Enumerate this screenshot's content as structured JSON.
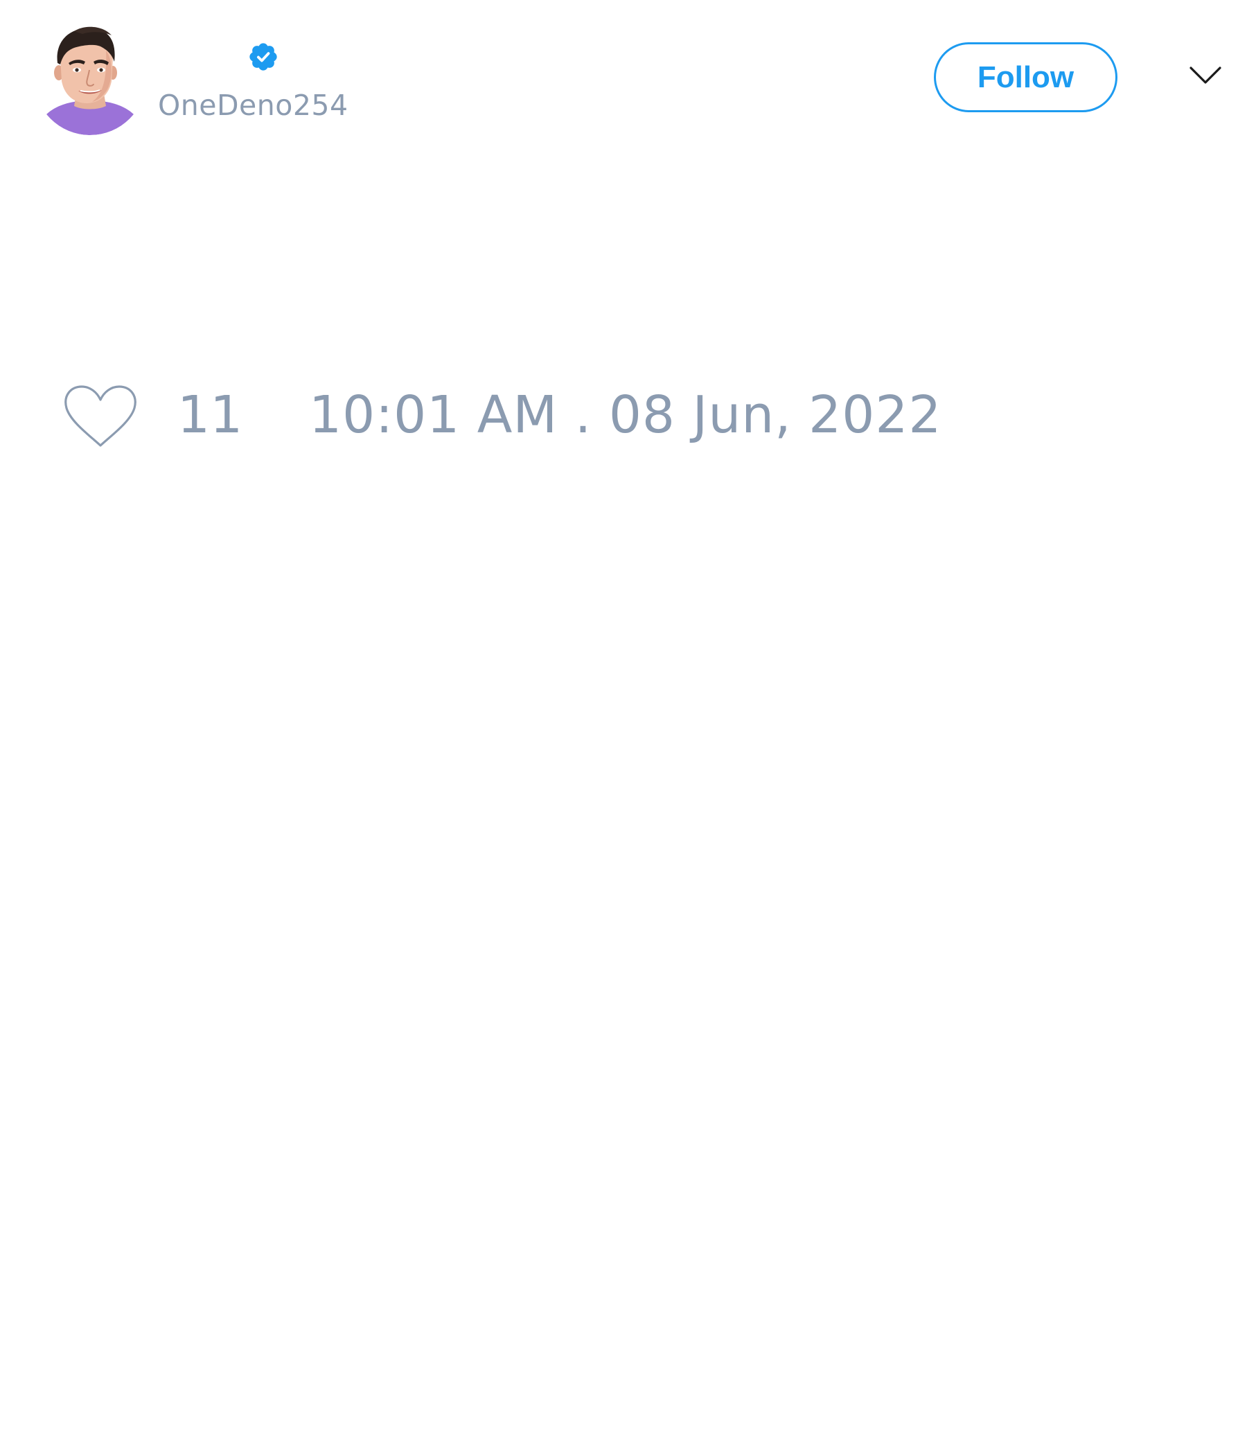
{
  "tweet": {
    "author": {
      "handle": "OneDeno254",
      "verified": true,
      "avatar_icon": "avatar-illustration"
    },
    "follow_label": "Follow",
    "menu_icon": "chevron-down-icon",
    "likes": {
      "icon": "heart-outline-icon",
      "count": "11"
    },
    "timestamp": "10:01 AM . 08 Jun, 2022"
  },
  "colors": {
    "accent": "#1d9bf0",
    "muted_text": "#8b9bb0",
    "icon_stroke": "#8b9bb0",
    "chevron": "#1a1a1a",
    "background": "#ffffff",
    "avatar_shirt": "#9b72d8"
  }
}
